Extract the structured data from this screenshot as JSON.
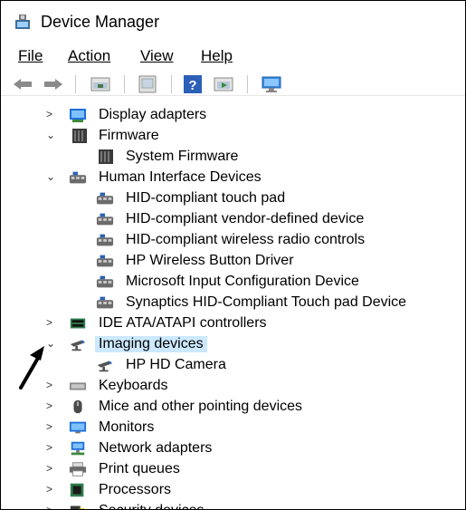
{
  "window": {
    "title": "Device Manager"
  },
  "menu": {
    "file": {
      "label": "File"
    },
    "action": {
      "label": "Action"
    },
    "view": {
      "label": "View"
    },
    "help": {
      "label": "Help"
    }
  },
  "toolbar": {
    "icons": [
      "back-arrow-icon",
      "forward-arrow-icon",
      "properties-icon",
      "update-driver-icon",
      "help-icon",
      "run-icon",
      "scan-hardware-icon"
    ]
  },
  "tree": [
    {
      "label": "Display adapters",
      "level": 0,
      "state": "collapsed",
      "icon": "display-adapter-icon"
    },
    {
      "label": "Firmware",
      "level": 0,
      "state": "expanded",
      "icon": "firmware-icon"
    },
    {
      "label": "System Firmware",
      "level": 1,
      "state": "leaf",
      "icon": "firmware-icon"
    },
    {
      "label": "Human Interface Devices",
      "level": 0,
      "state": "expanded",
      "icon": "hid-icon"
    },
    {
      "label": "HID-compliant touch pad",
      "level": 1,
      "state": "leaf",
      "icon": "hid-icon"
    },
    {
      "label": "HID-compliant vendor-defined device",
      "level": 1,
      "state": "leaf",
      "icon": "hid-icon"
    },
    {
      "label": "HID-compliant wireless radio controls",
      "level": 1,
      "state": "leaf",
      "icon": "hid-icon"
    },
    {
      "label": "HP Wireless Button Driver",
      "level": 1,
      "state": "leaf",
      "icon": "hid-icon"
    },
    {
      "label": "Microsoft Input Configuration Device",
      "level": 1,
      "state": "leaf",
      "icon": "hid-icon"
    },
    {
      "label": "Synaptics HID-Compliant Touch pad Device",
      "level": 1,
      "state": "leaf",
      "icon": "hid-icon"
    },
    {
      "label": "IDE ATA/ATAPI controllers",
      "level": 0,
      "state": "collapsed",
      "icon": "ide-controller-icon"
    },
    {
      "label": "Imaging devices",
      "level": 0,
      "state": "expanded",
      "icon": "camera-icon",
      "selected": true
    },
    {
      "label": "HP HD Camera",
      "level": 1,
      "state": "leaf",
      "icon": "camera-icon"
    },
    {
      "label": "Keyboards",
      "level": 0,
      "state": "collapsed",
      "icon": "keyboard-icon"
    },
    {
      "label": "Mice and other pointing devices",
      "level": 0,
      "state": "collapsed",
      "icon": "mouse-icon"
    },
    {
      "label": "Monitors",
      "level": 0,
      "state": "collapsed",
      "icon": "monitor-icon"
    },
    {
      "label": "Network adapters",
      "level": 0,
      "state": "collapsed",
      "icon": "network-adapter-icon"
    },
    {
      "label": "Print queues",
      "level": 0,
      "state": "collapsed",
      "icon": "printer-icon"
    },
    {
      "label": "Processors",
      "level": 0,
      "state": "collapsed",
      "icon": "processor-icon"
    },
    {
      "label": "Security devices",
      "level": 0,
      "state": "collapsed",
      "icon": "security-device-icon"
    }
  ],
  "colors": {
    "selection": "#cce8ff",
    "accent": "#1e6fd9"
  }
}
